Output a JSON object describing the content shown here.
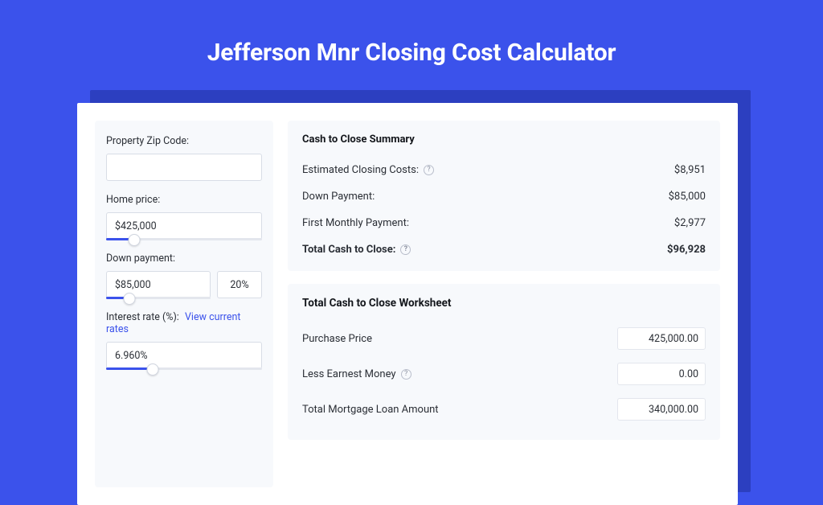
{
  "title": "Jefferson Mnr Closing Cost Calculator",
  "colors": {
    "accent": "#3B52EB",
    "panel": "#F7F9FC"
  },
  "left": {
    "zip": {
      "label": "Property Zip Code:",
      "value": ""
    },
    "home_price": {
      "label": "Home price:",
      "value": "$425,000",
      "slider_pct": 18
    },
    "down_payment": {
      "label": "Down payment:",
      "value": "$85,000",
      "pct": "20%",
      "slider_pct": 22
    },
    "interest": {
      "label": "Interest rate (%):",
      "link": "View current rates",
      "value": "6.960%",
      "slider_pct": 30
    }
  },
  "summary": {
    "title": "Cash to Close Summary",
    "rows": [
      {
        "label": "Estimated Closing Costs:",
        "value": "$8,951",
        "help": true
      },
      {
        "label": "Down Payment:",
        "value": "$85,000",
        "help": false
      },
      {
        "label": "First Monthly Payment:",
        "value": "$2,977",
        "help": false
      }
    ],
    "total": {
      "label": "Total Cash to Close:",
      "value": "$96,928",
      "help": true
    }
  },
  "worksheet": {
    "title": "Total Cash to Close Worksheet",
    "rows": [
      {
        "label": "Purchase Price",
        "value": "425,000.00",
        "help": false
      },
      {
        "label": "Less Earnest Money",
        "value": "0.00",
        "help": true
      },
      {
        "label": "Total Mortgage Loan Amount",
        "value": "340,000.00",
        "help": false
      }
    ]
  }
}
